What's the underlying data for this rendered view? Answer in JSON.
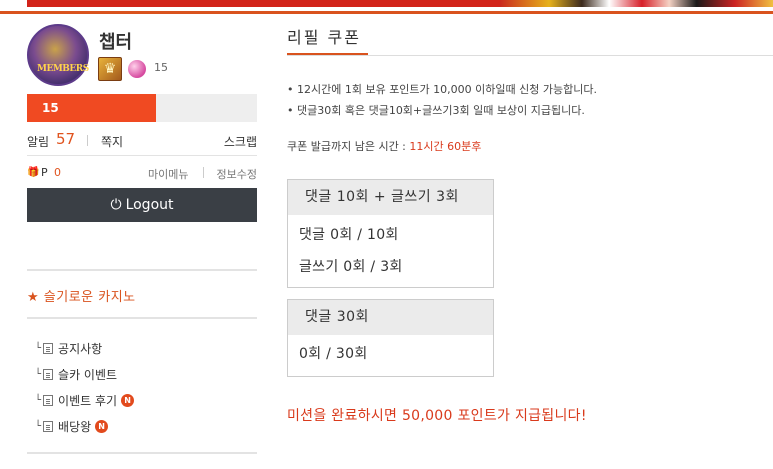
{
  "profile": {
    "nickname": "챕터",
    "avatar_text": "MEMBERS",
    "level": "15",
    "exp_label": "15",
    "exp_fraction": 0.56
  },
  "stats": {
    "alarm_label": "알림",
    "alarm_count": "57",
    "memo_label": "쪽지",
    "scrap_label": "스크랩",
    "point_label": "P",
    "point_value": "0",
    "mymenu_label": "마이메뉴",
    "editinfo_label": "정보수정"
  },
  "logout_label": "Logout",
  "menu": {
    "title": "★ 슬기로운 카지노",
    "items": [
      {
        "label": "공지사항",
        "badge": ""
      },
      {
        "label": "슬카 이벤트",
        "badge": ""
      },
      {
        "label": "이벤트 후기",
        "badge": "N"
      },
      {
        "label": "배당왕",
        "badge": "N"
      }
    ]
  },
  "main": {
    "title": "리필 쿠폰",
    "notes": [
      "• 12시간에 1회 보유 포인트가 10,000 이하일때 신청 가능합니다.",
      "• 댓글30회 혹은 댓글10회+글쓰기3회 일때 보상이 지급됩니다."
    ],
    "countdown_label": "쿠폰 발급까지 남은 시간 : ",
    "countdown_value": "11시간 60분후",
    "box1": {
      "header": "댓글 10회 + 글쓰기 3회",
      "lines": [
        "댓글 0회 / 10회",
        "글쓰기 0회 / 3회"
      ]
    },
    "box2": {
      "header": "댓글 30회",
      "lines": [
        "0회 / 30회"
      ]
    },
    "mission_text": "미션을 완료하시면 50,000 포인트가 지급됩니다!"
  },
  "colors": {
    "accent": "#d9531e",
    "exp_fill": "#f04a22",
    "logout_bg": "#3a3f45",
    "highlight_red": "#d93a1c"
  }
}
